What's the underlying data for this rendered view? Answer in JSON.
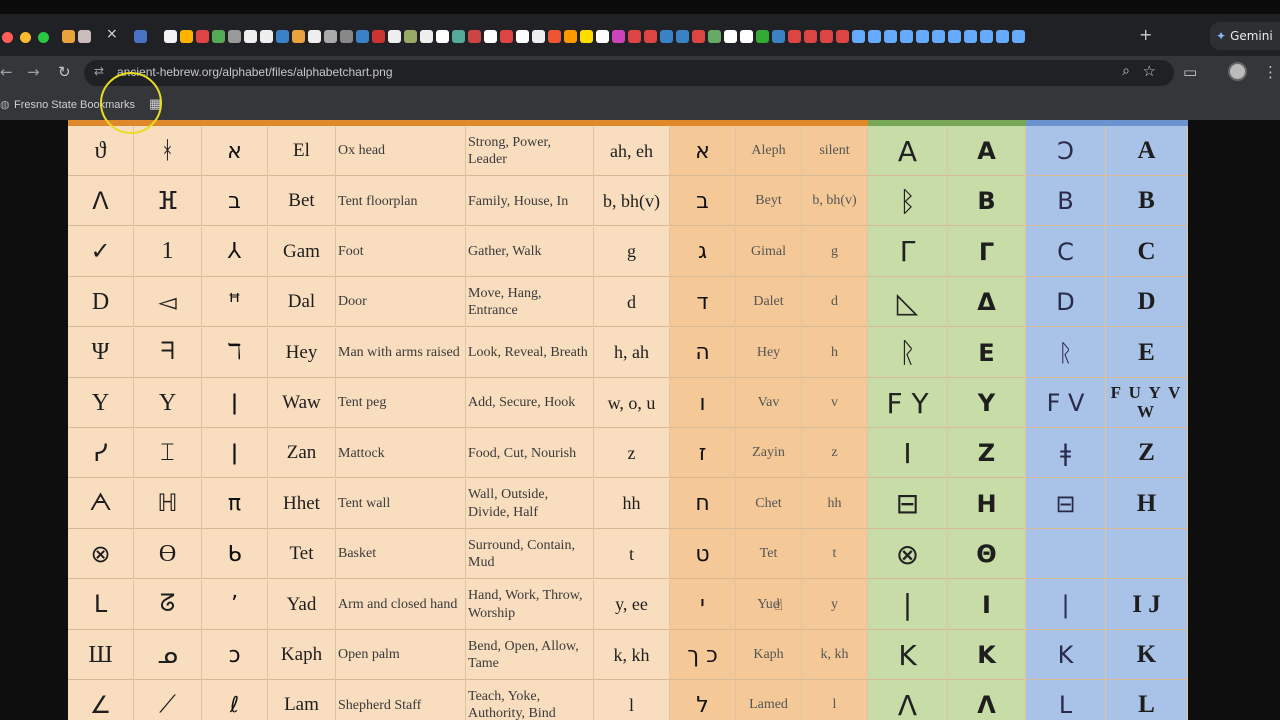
{
  "browser": {
    "tab_close": "×",
    "new_tab": "+",
    "gemini_label": "Gemini",
    "url": "ancient-hebrew.org/alphabet/files/alphabetchart.png",
    "bookmark_label": "Fresno State Bookmarks",
    "icons": {
      "back": "←",
      "forward": "→",
      "reload": "↻",
      "tune": "⇄",
      "zoom": "⌕",
      "star": "☆",
      "apps": "▦"
    }
  },
  "colors": {
    "col_group_1": "#f8ddbf",
    "col_group_2": "#f4c997",
    "col_group_3": "#c8dca7",
    "col_group_4": "#a9c2e7"
  },
  "rows": [
    {
      "early": "ϑ",
      "middle": "ᚼ",
      "late": "א",
      "name": "El",
      "meaning": "Ox head",
      "verbs": "Strong, Power, Leader",
      "sound": "ah, eh",
      "modern": "א",
      "modern_name": "Aleph",
      "modern_sound": "silent",
      "greek_early": "A",
      "greek": "A",
      "latin_early": "Ↄ",
      "latin": "A"
    },
    {
      "early": "ⴷ",
      "middle": "ⴼ",
      "late": "ב",
      "name": "Bet",
      "meaning": "Tent floorplan",
      "verbs": "Family, House, In",
      "sound": "b, bh(v)",
      "modern": "ב",
      "modern_name": "Beyt",
      "modern_sound": "b, bh(v)",
      "greek_early": "ᛒ",
      "greek": "B",
      "latin_early": "B",
      "latin": "B"
    },
    {
      "early": "✓",
      "middle": "1",
      "late": "⅄",
      "name": "Gam",
      "meaning": "Foot",
      "verbs": "Gather, Walk",
      "sound": "g",
      "modern": "ג",
      "modern_name": "Gimal",
      "modern_sound": "g",
      "greek_early": "Γ",
      "greek": "Γ",
      "latin_early": "C",
      "latin": "C"
    },
    {
      "early": "D",
      "middle": "◅",
      "late": "ꟸ",
      "name": "Dal",
      "meaning": "Door",
      "verbs": "Move, Hang, Entrance",
      "sound": "d",
      "modern": "ד",
      "modern_name": "Dalet",
      "modern_sound": "d",
      "greek_early": "◺",
      "greek": "Δ",
      "latin_early": "D",
      "latin": "D"
    },
    {
      "early": "Ψ",
      "middle": "ᖷ",
      "late": "ℸ",
      "name": "Hey",
      "meaning": "Man with arms raised",
      "verbs": "Look, Reveal, Breath",
      "sound": "h, ah",
      "modern": "ה",
      "modern_name": "Hey",
      "modern_sound": "h",
      "greek_early": "ᚱ",
      "greek": "E",
      "latin_early": "ᚱ",
      "latin": "E"
    },
    {
      "early": "Y",
      "middle": "Y",
      "late": "ǀ",
      "name": "Waw",
      "meaning": "Tent peg",
      "verbs": "Add, Secure, Hook",
      "sound": "w, o, u",
      "modern": "ו",
      "modern_name": "Vav",
      "modern_sound": "v",
      "greek_early": "F Y",
      "greek": "Y",
      "latin_early": "F V",
      "latin": "F U Y V W"
    },
    {
      "early": "ᓯ",
      "middle": "⌶",
      "late": "ǀ",
      "name": "Zan",
      "meaning": "Mattock",
      "verbs": "Food, Cut, Nourish",
      "sound": "z",
      "modern": "ז",
      "modern_name": "Zayin",
      "modern_sound": "z",
      "greek_early": "I",
      "greek": "Z",
      "latin_early": "ǂ",
      "latin": "Z"
    },
    {
      "early": "ᗅ",
      "middle": "ℍ",
      "late": "π",
      "name": "Hhet",
      "meaning": "Tent wall",
      "verbs": "Wall, Outside, Divide, Half",
      "sound": "hh",
      "modern": "ח",
      "modern_name": "Chet",
      "modern_sound": "hh",
      "greek_early": "⊟",
      "greek": "H",
      "latin_early": "⊟",
      "latin": "H"
    },
    {
      "early": "⊗",
      "middle": "ϴ",
      "late": "ᑲ",
      "name": "Tet",
      "meaning": "Basket",
      "verbs": "Surround, Contain, Mud",
      "sound": "t",
      "modern": "ט",
      "modern_name": "Tet",
      "modern_sound": "t",
      "greek_early": "⊗",
      "greek": "Θ",
      "latin_early": "",
      "latin": ""
    },
    {
      "early": "ᒪ",
      "middle": "ᘔ",
      "late": "ʼ",
      "name": "Yad",
      "meaning": "Arm and closed hand",
      "verbs": "Hand, Work, Throw, Worship",
      "sound": "y, ee",
      "modern": "י",
      "modern_name": "Yud",
      "modern_sound": "y",
      "greek_early": "|",
      "greek": "I",
      "latin_early": "|",
      "latin": "I J"
    },
    {
      "early": "Ш",
      "middle": "ᓄ",
      "late": "ɔ",
      "name": "Kaph",
      "meaning": "Open palm",
      "verbs": "Bend, Open, Allow, Tame",
      "sound": "k, kh",
      "modern": "כ ך",
      "modern_name": "Kaph",
      "modern_sound": "k, kh",
      "greek_early": "K",
      "greek": "K",
      "latin_early": "K",
      "latin": "K"
    },
    {
      "early": "∠",
      "middle": "⟋",
      "late": "ℓ",
      "name": "Lam",
      "meaning": "Shepherd Staff",
      "verbs": "Teach, Yoke, Authority, Bind",
      "sound": "l",
      "modern": "ל",
      "modern_name": "Lamed",
      "modern_sound": "l",
      "greek_early": "Λ",
      "greek": "Λ",
      "latin_early": "L",
      "latin": "L"
    }
  ]
}
